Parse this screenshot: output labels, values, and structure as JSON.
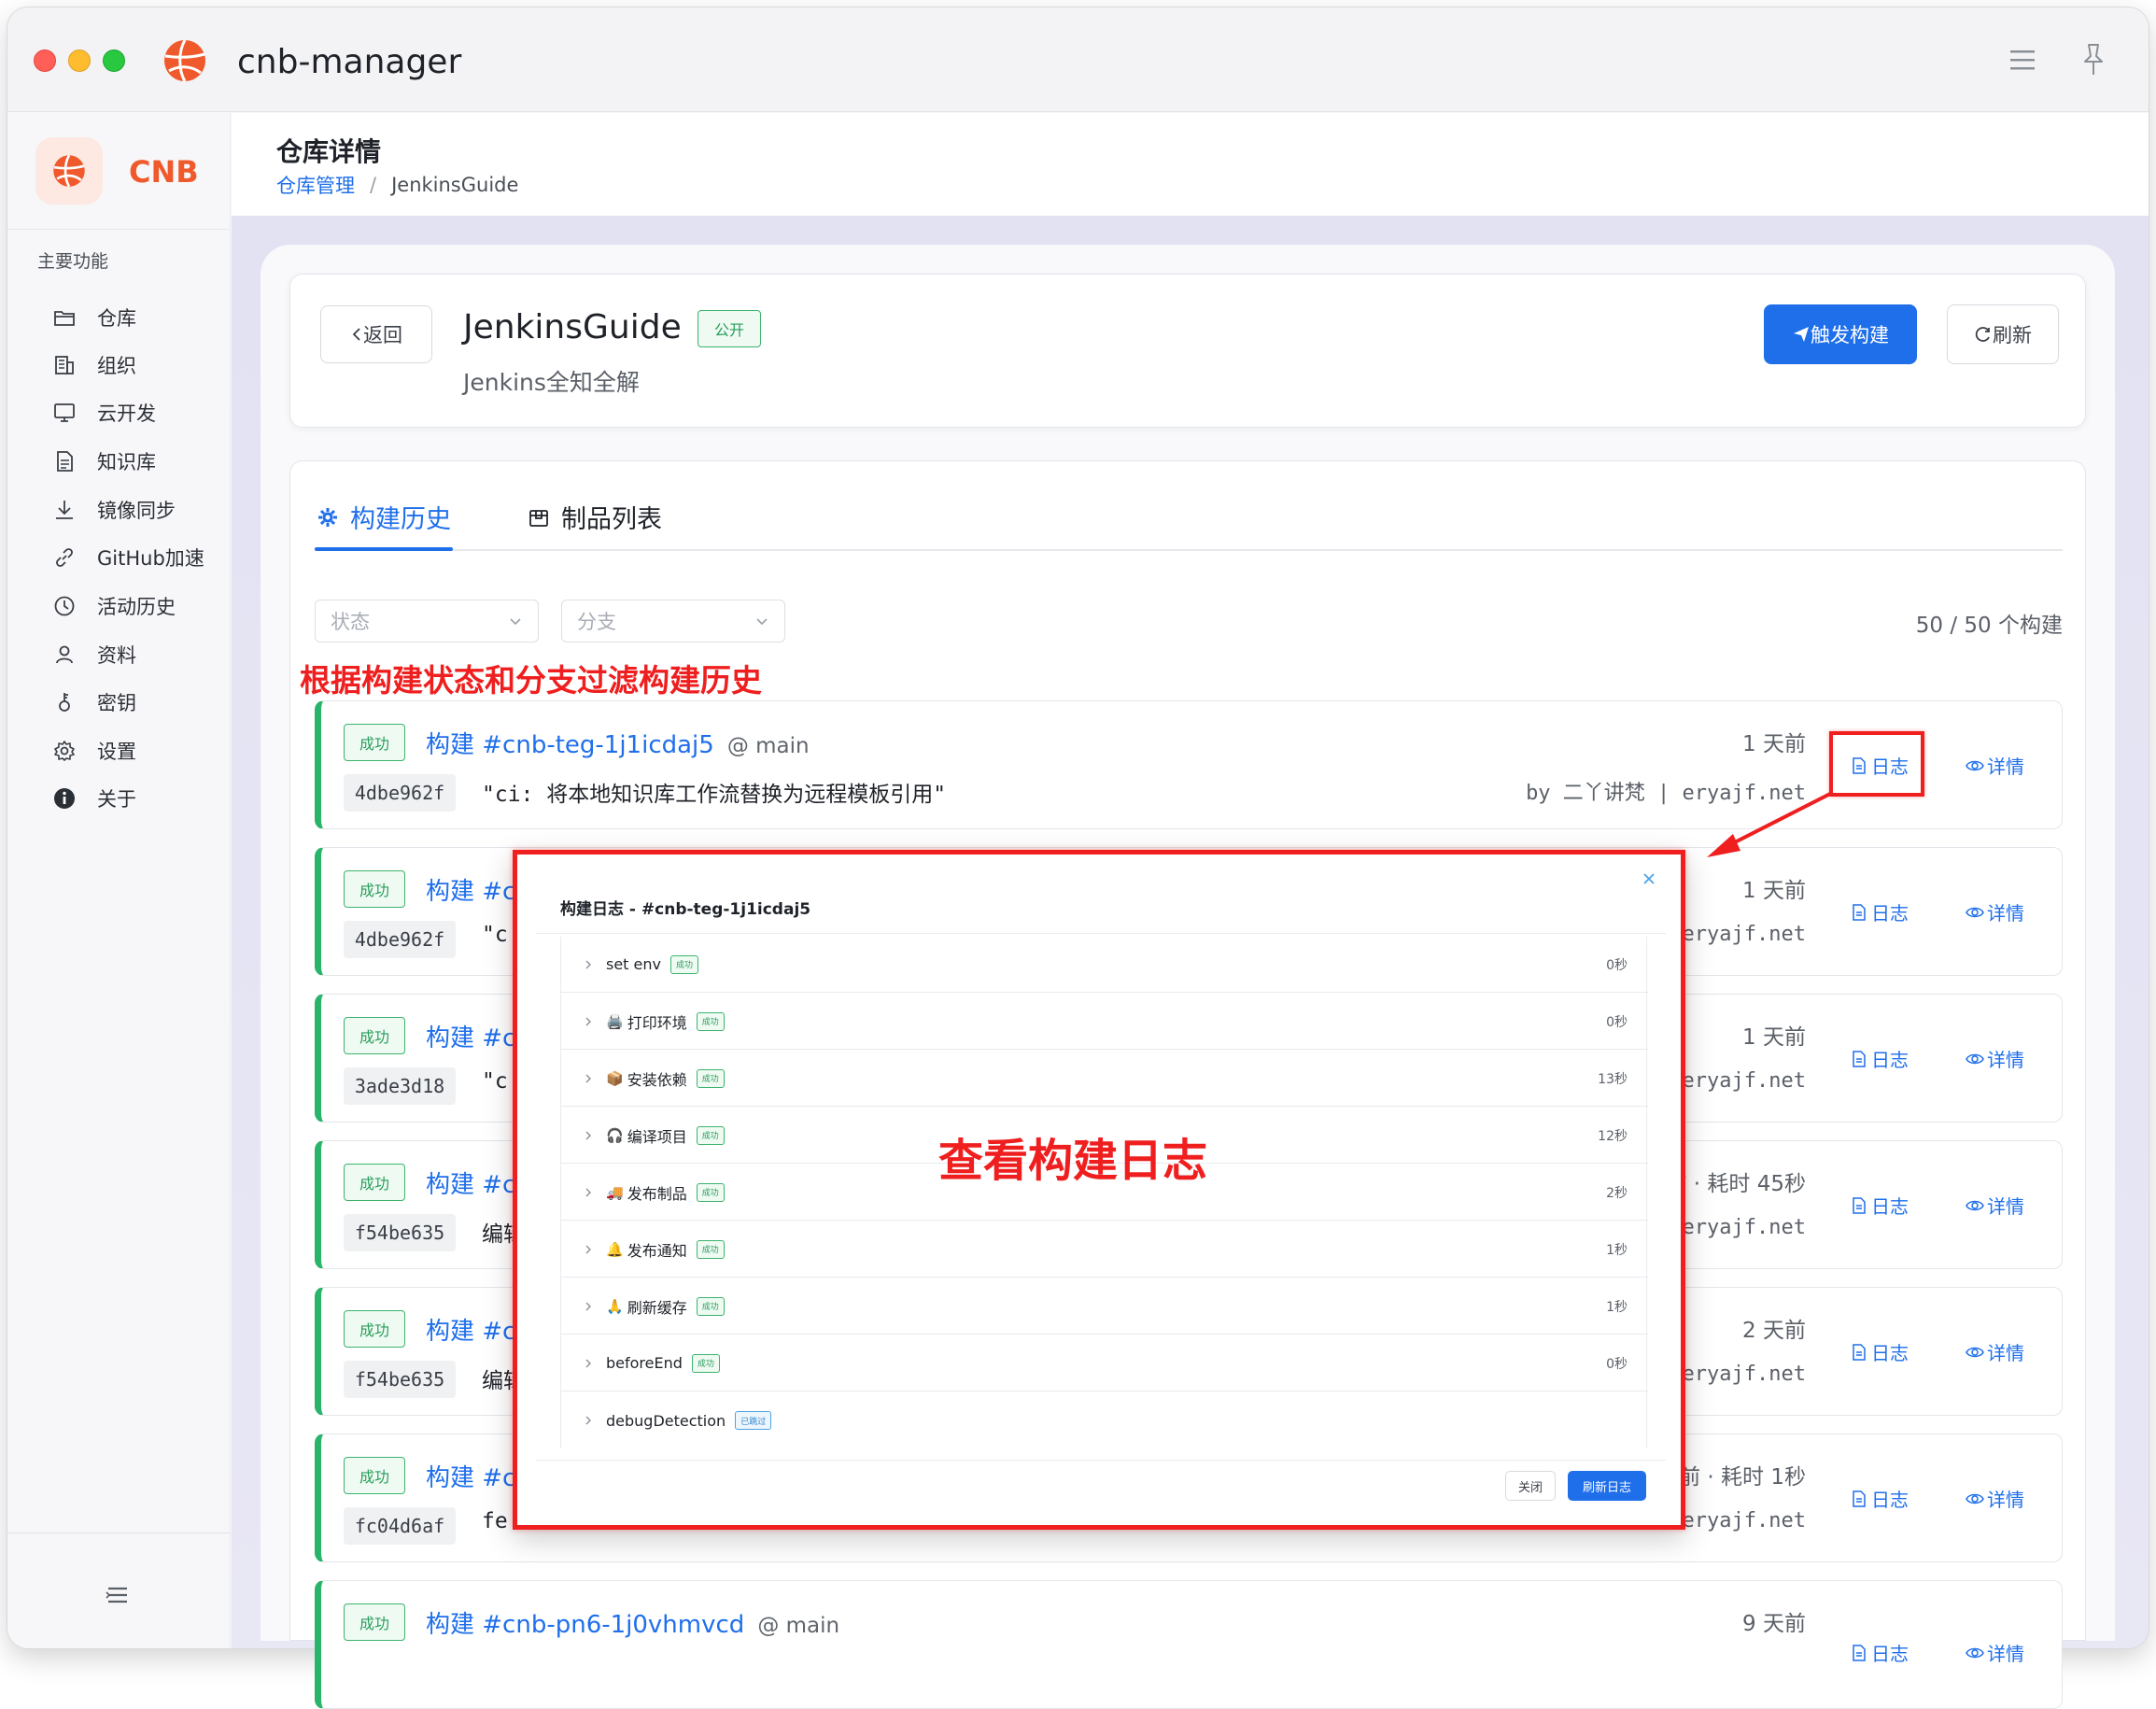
{
  "window": {
    "app_title": "cnb-manager"
  },
  "sidebar": {
    "brand": "CNB",
    "section_label": "主要功能",
    "items": [
      {
        "label": "仓库",
        "icon": "folder-icon"
      },
      {
        "label": "组织",
        "icon": "building-icon"
      },
      {
        "label": "云开发",
        "icon": "monitor-icon"
      },
      {
        "label": "知识库",
        "icon": "document-icon"
      },
      {
        "label": "镜像同步",
        "icon": "download-icon"
      },
      {
        "label": "GitHub加速",
        "icon": "link-icon"
      },
      {
        "label": "活动历史",
        "icon": "clock-icon"
      },
      {
        "label": "资料",
        "icon": "user-icon"
      },
      {
        "label": "密钥",
        "icon": "key-icon"
      },
      {
        "label": "设置",
        "icon": "gear-icon"
      },
      {
        "label": "关于",
        "icon": "info-icon"
      }
    ]
  },
  "header": {
    "title": "仓库详情",
    "breadcrumb": [
      "仓库管理",
      "/",
      "JenkinsGuide"
    ]
  },
  "repo": {
    "back_label": "返回",
    "name": "JenkinsGuide",
    "visibility": "公开",
    "description": "Jenkins全知全解",
    "trigger_label": "触发构建",
    "refresh_label": "刷新"
  },
  "tabs": [
    {
      "label": "构建历史",
      "active": true
    },
    {
      "label": "制品列表",
      "active": false
    }
  ],
  "filters": {
    "status_placeholder": "状态",
    "branch_placeholder": "分支",
    "count": "50 / 50 个构建"
  },
  "annotations": {
    "filter": "根据构建状态和分支过滤构建历史",
    "log": "查看构建日志"
  },
  "builds": [
    {
      "status": "成功",
      "title": "构建 #cnb-teg-1j1icdaj5",
      "branch": "@ main",
      "hash": "4dbe962f",
      "message": "\"ci: 将本地知识库工作流替换为远程模板引用\"",
      "time": "1 天前",
      "author": "by 二丫讲梵 | eryajf.net",
      "log": "日志",
      "detail": "详情"
    },
    {
      "status": "成功",
      "title": "构建 #c",
      "branch": "",
      "hash": "4dbe962f",
      "message": "\"c",
      "time": "1 天前",
      "author": "eryajf.net",
      "log": "日志",
      "detail": "详情"
    },
    {
      "status": "成功",
      "title": "构建 #c",
      "branch": "",
      "hash": "3ade3d18",
      "message": "\"c",
      "time": "1 天前",
      "author": "eryajf.net",
      "log": "日志",
      "detail": "详情"
    },
    {
      "status": "成功",
      "title": "构建 #c",
      "branch": "",
      "hash": "f54be635",
      "message": "编辑",
      "time": "前 · 耗时 45秒",
      "author": "eryajf.net",
      "log": "日志",
      "detail": "详情"
    },
    {
      "status": "成功",
      "title": "构建 #c",
      "branch": "",
      "hash": "f54be635",
      "message": "编辑",
      "time": "2 天前",
      "author": "eryajf.net",
      "log": "日志",
      "detail": "详情"
    },
    {
      "status": "成功",
      "title": "构建 #c",
      "branch": "",
      "hash": "fc04d6af",
      "message": "fe",
      "time": "前 · 耗时 1秒",
      "author": "eryajf.net",
      "log": "日志",
      "detail": "详情"
    },
    {
      "status": "成功",
      "title": "构建 #cnb-pn6-1j0vhmvcd",
      "branch": "@ main",
      "hash": "",
      "message": "",
      "time": "9 天前",
      "author": "",
      "log": "日志",
      "detail": "详情"
    }
  ],
  "log_modal": {
    "title": "构建日志 - #cnb-teg-1j1icdaj5",
    "steps": [
      {
        "emoji": "",
        "name": "set env",
        "status": "成功",
        "duration": "0秒"
      },
      {
        "emoji": "🖨️",
        "name": "打印环境",
        "status": "成功",
        "duration": "0秒"
      },
      {
        "emoji": "📦",
        "name": "安装依赖",
        "status": "成功",
        "duration": "13秒"
      },
      {
        "emoji": "🎧",
        "name": "编译项目",
        "status": "成功",
        "duration": "12秒"
      },
      {
        "emoji": "🚚",
        "name": "发布制品",
        "status": "成功",
        "duration": "2秒"
      },
      {
        "emoji": "🔔",
        "name": "发布通知",
        "status": "成功",
        "duration": "1秒"
      },
      {
        "emoji": "🙏",
        "name": "刷新缓存",
        "status": "成功",
        "duration": "1秒"
      },
      {
        "emoji": "",
        "name": "beforeEnd",
        "status": "成功",
        "duration": "0秒"
      },
      {
        "emoji": "",
        "name": "debugDetection",
        "status": "已跳过",
        "duration": ""
      }
    ],
    "close_label": "关闭",
    "refresh_label": "刷新日志"
  },
  "colors": {
    "primary": "#1f6feb",
    "success": "#28b46a",
    "annotation": "#ef1f1f",
    "brand": "#f0592b"
  }
}
